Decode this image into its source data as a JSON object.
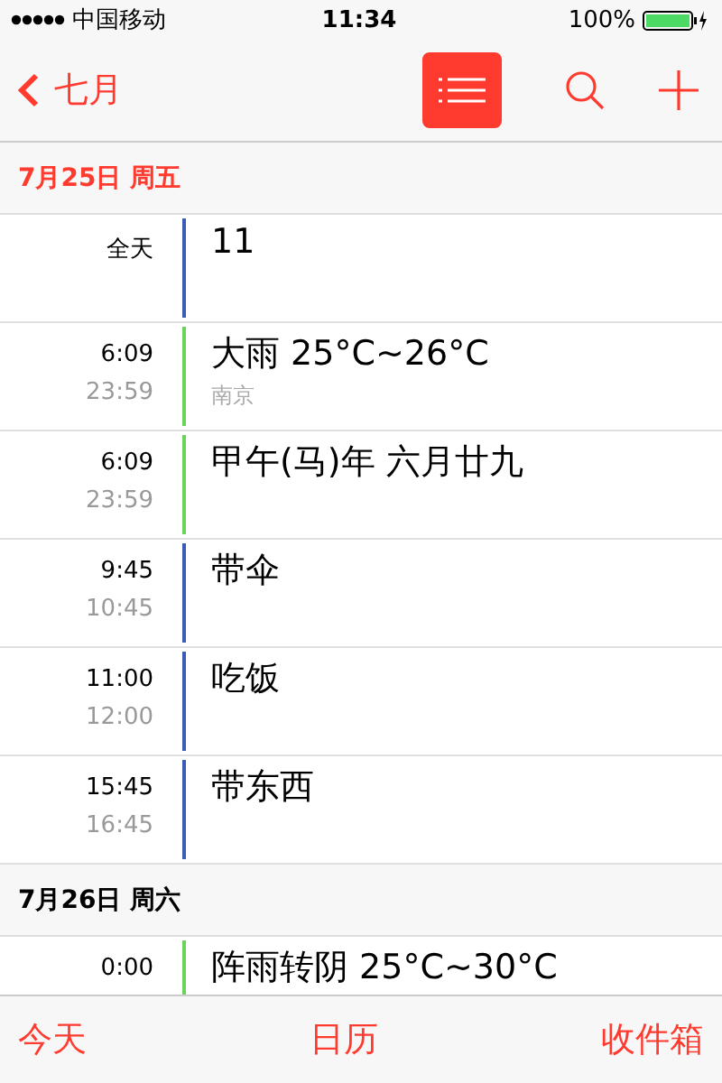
{
  "status_bar": {
    "carrier": "中国移动",
    "time": "11:34",
    "battery_percent": "100%"
  },
  "nav": {
    "back": "七月",
    "list_view_selected": true
  },
  "days": [
    {
      "header": "7月25日 周五",
      "today": true,
      "events": [
        {
          "start": "全天",
          "title": "11",
          "color": "#3b5bb5"
        },
        {
          "start": "6:09",
          "end": "23:59",
          "title": "大雨 25°C~26°C",
          "location": "南京",
          "color": "#6ad35a"
        },
        {
          "start": "6:09",
          "end": "23:59",
          "title": "甲午(马)年 六月廿九",
          "color": "#6ad35a"
        },
        {
          "start": "9:45",
          "end": "10:45",
          "title": "带伞",
          "color": "#3b5bb5"
        },
        {
          "start": "11:00",
          "end": "12:00",
          "title": "吃饭",
          "color": "#3b5bb5"
        },
        {
          "start": "15:45",
          "end": "16:45",
          "title": "带东西",
          "color": "#3b5bb5"
        }
      ]
    },
    {
      "header": "7月26日 周六",
      "today": false,
      "events": [
        {
          "start": "0:00",
          "title": "阵雨转阴 25°C~30°C",
          "color": "#6ad35a"
        }
      ]
    }
  ],
  "toolbar": [
    "今天",
    "日历",
    "收件箱"
  ]
}
